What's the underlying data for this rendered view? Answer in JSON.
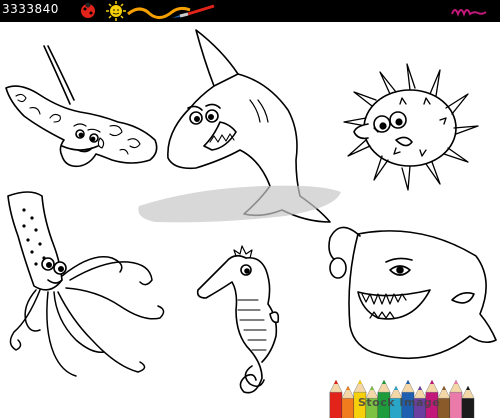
{
  "header": {
    "stock_id": "3333840",
    "logo_icons": [
      "ladybug-icon",
      "sun-icon",
      "paintbrush-icon"
    ],
    "signature": "m"
  },
  "illustration": {
    "figures": [
      "manta-ray",
      "shark",
      "pufferfish",
      "squid",
      "seahorse",
      "anglerfish"
    ],
    "colored_pencils": [
      "#e2231a",
      "#f07c1e",
      "#f6d10b",
      "#7ec242",
      "#1e9b3a",
      "#29a6c7",
      "#1f5fb0",
      "#6b3fa0",
      "#c2187a",
      "#8b5a2b",
      "#e97aa9",
      "#1b1b1b"
    ]
  },
  "watermark": {
    "bottom_text": "Stock Image",
    "bottom_brand": "Stock"
  },
  "colors": {
    "bar": "#000000",
    "signature": "#c2187a"
  }
}
